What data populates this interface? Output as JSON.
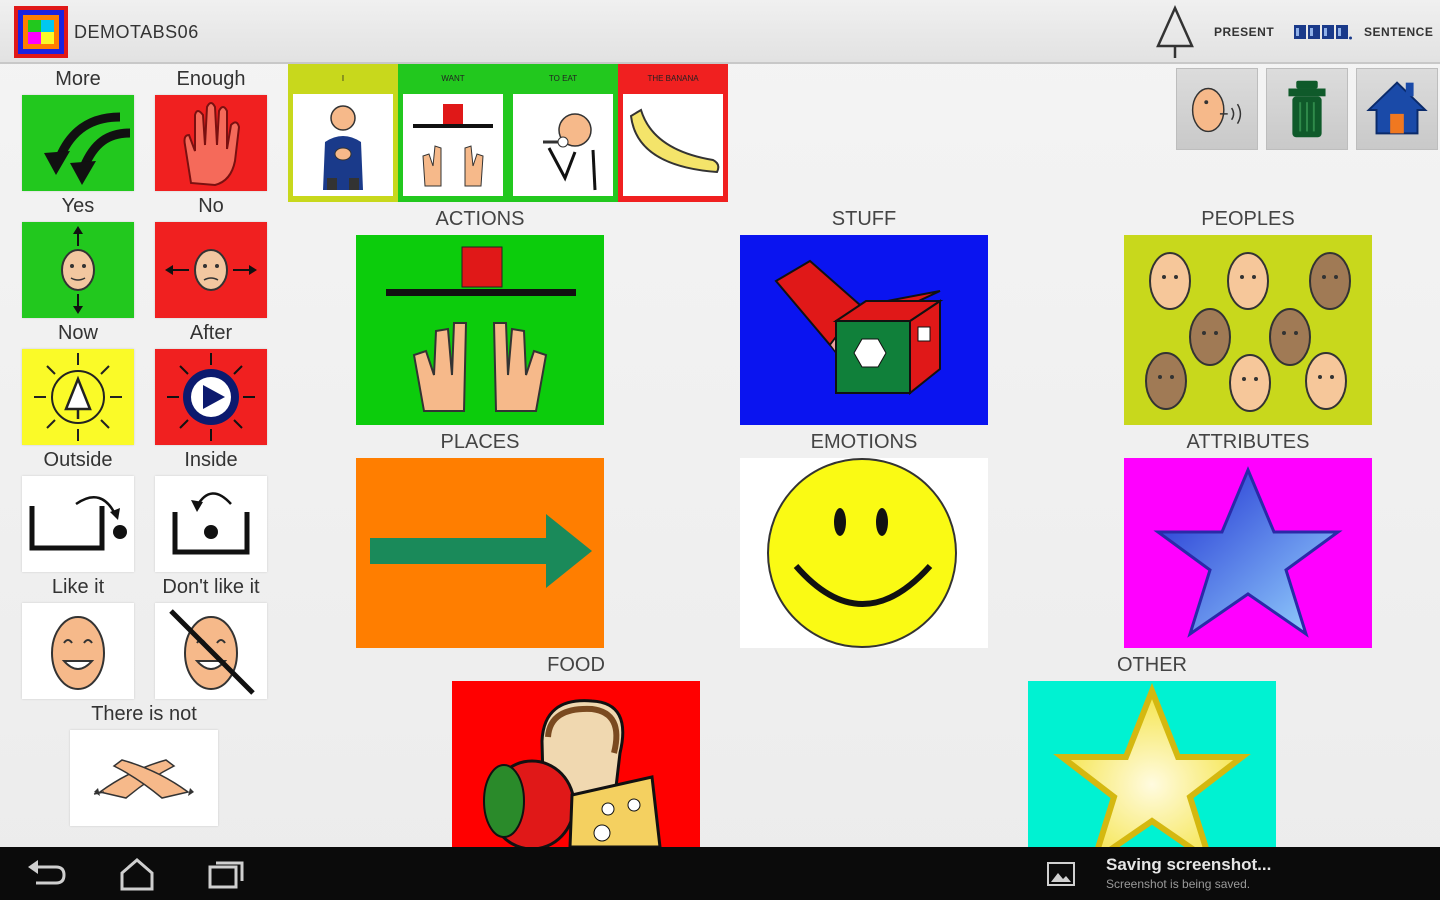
{
  "app": {
    "title": "DEMOTABS06"
  },
  "toolbar": {
    "present_label": "PRESENT",
    "sentence_label": "SENTENCE",
    "tree_icon": "tree-icon",
    "sentence_icon": "bar-grid-icon",
    "tools": [
      {
        "name": "speak-icon"
      },
      {
        "name": "trash-icon"
      },
      {
        "name": "home-icon"
      }
    ]
  },
  "quick_cells": [
    {
      "label": "More",
      "color": "#22c81e"
    },
    {
      "label": "Enough",
      "color": "#f02020"
    },
    {
      "label": "Yes",
      "color": "#22c81e"
    },
    {
      "label": "No",
      "color": "#f02020"
    },
    {
      "label": "Now",
      "color": "#fafa28"
    },
    {
      "label": "After",
      "color": "#f02020"
    },
    {
      "label": "Outside",
      "color": "#ffffff"
    },
    {
      "label": "Inside",
      "color": "#ffffff"
    },
    {
      "label": "Like it",
      "color": "#ffffff"
    },
    {
      "label": "Don't like it",
      "color": "#ffffff"
    },
    {
      "label": "There is not",
      "color": "#ffffff"
    }
  ],
  "sentence": [
    {
      "word": "I",
      "color": "#c8d81c"
    },
    {
      "word": "WANT",
      "color": "#22c81e"
    },
    {
      "word": "TO EAT",
      "color": "#22c81e"
    },
    {
      "word": "THE BANANA",
      "color": "#f02020"
    }
  ],
  "categories": [
    {
      "label": "ACTIONS",
      "color": "#0ccc0c"
    },
    {
      "label": "STUFF",
      "color": "#0a14f0"
    },
    {
      "label": "PEOPLES",
      "color": "#c8d81c"
    },
    {
      "label": "PLACES",
      "color": "#ff7e00"
    },
    {
      "label": "EMOTIONS",
      "color": "#ffffff"
    },
    {
      "label": "ATTRIBUTES",
      "color": "#ff00ff"
    },
    {
      "label": "FOOD",
      "color": "#ff0000"
    },
    {
      "label": "OTHER",
      "color": "#00f2d2"
    }
  ],
  "notification": {
    "title": "Saving screenshot...",
    "subtitle": "Screenshot is being saved."
  }
}
